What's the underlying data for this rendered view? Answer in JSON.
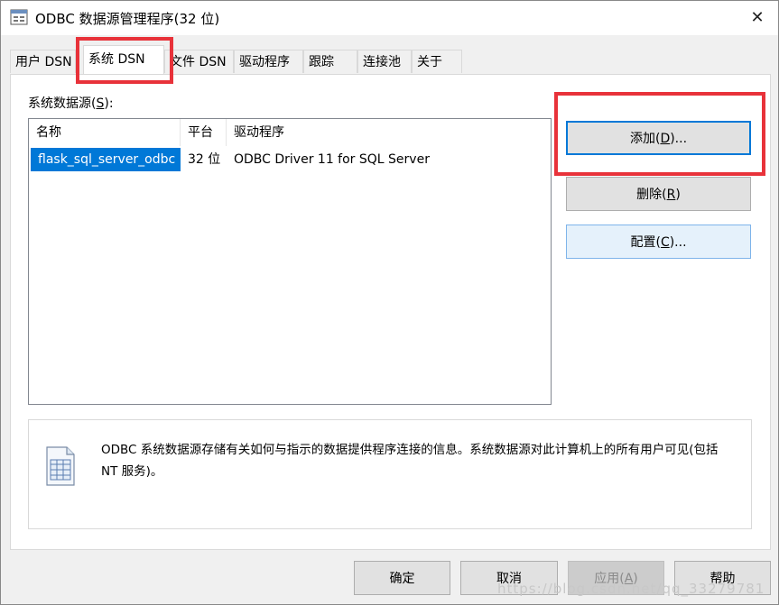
{
  "window": {
    "title": "ODBC 数据源管理程序(32 位)",
    "close_glyph": "✕"
  },
  "tabs": [
    {
      "label": "用户 DSN",
      "active": false
    },
    {
      "label": "系统 DSN",
      "active": true
    },
    {
      "label": "文件 DSN",
      "active": false
    },
    {
      "label": "驱动程序",
      "active": false
    },
    {
      "label": "跟踪",
      "active": false
    },
    {
      "label": "连接池",
      "active": false
    },
    {
      "label": "关于",
      "active": false
    }
  ],
  "list": {
    "label_pre": "系统数据源(",
    "label_key": "S",
    "label_post": "):",
    "columns": [
      "名称",
      "平台",
      "驱动程序"
    ],
    "rows": [
      {
        "name": "flask_sql_server_odbc",
        "platform": "32 位",
        "driver": "ODBC Driver 11 for SQL Server",
        "selected": true
      }
    ]
  },
  "buttons": {
    "add": {
      "pre": "添加(",
      "key": "D",
      "post": ")..."
    },
    "remove": {
      "pre": "删除(",
      "key": "R",
      "post": ")"
    },
    "configure": {
      "pre": "配置(",
      "key": "C",
      "post": ")..."
    }
  },
  "info": {
    "text": "ODBC 系统数据源存储有关如何与指示的数据提供程序连接的信息。系统数据源对此计算机上的所有用户可见(包括 NT 服务)。",
    "icon": "data-source-icon"
  },
  "footer": {
    "ok": "确定",
    "cancel": "取消",
    "apply": {
      "pre": "应用(",
      "key": "A",
      "post": ")"
    },
    "help": "帮助"
  },
  "watermark": "https://blog.csdn.net/qq_33279781",
  "colors": {
    "accent": "#0078d7",
    "highlight_box": "#e8323a"
  }
}
